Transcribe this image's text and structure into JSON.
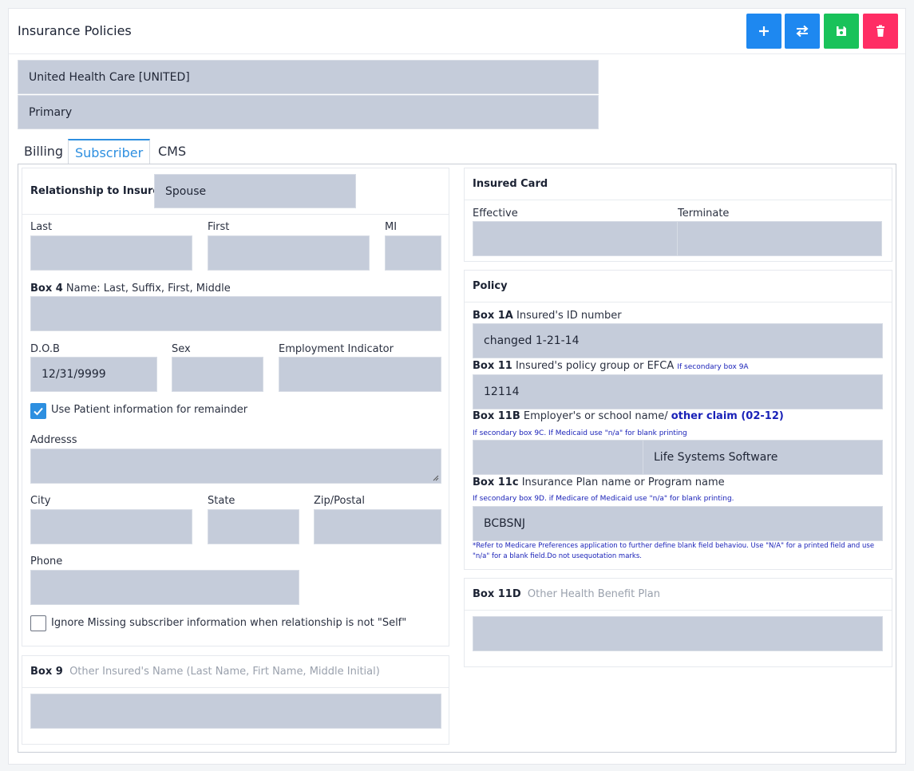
{
  "page": {
    "title": "Insurance Policies"
  },
  "toolbar": {
    "add_icon": "plus-icon",
    "swap_icon": "swap-arrows-icon",
    "save_icon": "floppy-save-icon",
    "delete_icon": "trash-icon",
    "colors": {
      "add": "#1e88f0",
      "swap": "#1e88f0",
      "save": "#19c25a",
      "delete": "#ff2d64"
    }
  },
  "policy_selector": {
    "carrier": "United Health Care [UNITED]",
    "priority": "Primary"
  },
  "tabs": [
    {
      "label": "Billing",
      "active": false
    },
    {
      "label": "Subscriber",
      "active": true
    },
    {
      "label": "CMS",
      "active": false
    }
  ],
  "subscriber": {
    "relationship_label": "Relationship to Insured",
    "relationship_value": "Spouse",
    "last_label": "Last",
    "first_label": "First",
    "mi_label": "MI",
    "last_value": "",
    "first_value": "",
    "mi_value": "",
    "box4_bold": "Box 4",
    "box4_label": " Name: Last, Suffix, First, Middle",
    "box4_value": "",
    "dob_label": "D.O.B",
    "dob_value": "12/31/9999",
    "sex_label": "Sex",
    "sex_value": "",
    "employment_label": "Employment Indicator",
    "employment_value": "",
    "use_patient_label": "Use Patient information for remainder",
    "use_patient_checked": true,
    "address_label": "Addresss",
    "address_value": "",
    "city_label": "City",
    "state_label": "State",
    "zip_label": "Zip/Postal",
    "city_value": "",
    "state_value": "",
    "zip_value": "",
    "phone_label": "Phone",
    "phone_value": "",
    "ignore_missing_label": "Ignore Missing subscriber information when relationship is not \"Self\"",
    "ignore_missing_checked": false
  },
  "box9": {
    "bold": "Box 9",
    "label": "Other Insured's Name (Last Name, Firt Name, Middle Initial)",
    "value": ""
  },
  "insured_card": {
    "title": "Insured Card",
    "effective_label": "Effective",
    "terminate_label": "Terminate",
    "effective_value": "",
    "terminate_value": ""
  },
  "policy": {
    "title": "Policy",
    "box1a_bold": "Box 1A",
    "box1a_label": " Insured's ID number",
    "box1a_value": "changed 1-21-14",
    "box11_bold": "Box 11",
    "box11_label": " Insured's policy group or EFCA ",
    "box11_note": "If secondary box 9A",
    "box11_value": "12114",
    "box11b_bold": "Box 11B",
    "box11b_label": " Employer's or school name/ ",
    "box11b_blue": "other claim (02-12)",
    "box11b_note": "If secondary box 9C. If Medicaid use \"n/a\" for blank printing",
    "box11b_code": "",
    "box11b_value": "Life Systems Software",
    "box11c_bold": "Box 11c",
    "box11c_label": " Insurance Plan name or Program name",
    "box11c_note": "If secondary box 9D. if Medicare of Medicaid use \"n/a\" for blank printing.",
    "box11c_value": "BCBSNJ",
    "footnote_line1": "*Refer to Medicare Preferences application to further define blank field behaviou. Use \"N/A\" for a printed field and use",
    "footnote_line2": "\"n/a\" for a blank field.Do not usequotation marks."
  },
  "box11d": {
    "bold": "Box 11D",
    "label": "Other Health Benefit Plan",
    "value": ""
  }
}
